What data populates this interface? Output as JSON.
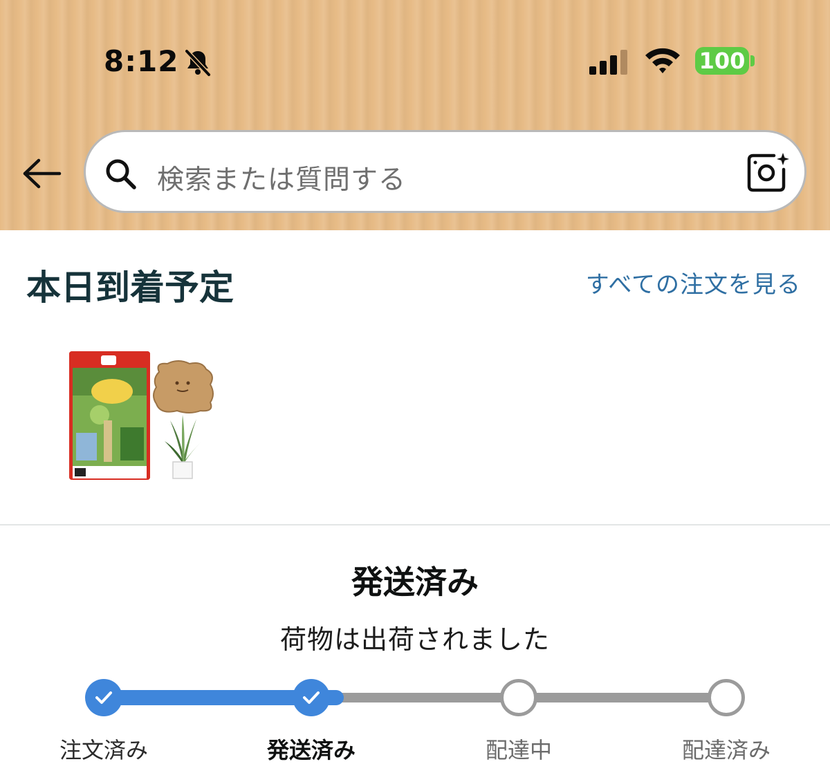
{
  "status_bar": {
    "time": "8:12",
    "battery": "100",
    "battery_color": "#5ecb45",
    "icons": [
      "bell-slash-icon",
      "cellular-signal-icon",
      "wifi-icon",
      "battery-icon"
    ]
  },
  "header": {
    "background_color": "#e7bb86",
    "search": {
      "placeholder": "検索または質問する",
      "icons": [
        "back-arrow-icon",
        "search-icon",
        "camera-lens-icon"
      ]
    }
  },
  "delivery": {
    "title": "本日到着予定",
    "view_all_link": "すべての注文を見る",
    "link_color": "#2f6fa3",
    "products": [
      {
        "name": "game-package-image"
      },
      {
        "name": "wooden-plate-image"
      },
      {
        "name": "potted-plant-image"
      }
    ]
  },
  "shipment": {
    "status_title": "発送済み",
    "status_message": "荷物は出荷されました",
    "progress_color": "#3f86db",
    "progress_fraction": 0.385,
    "steps": [
      {
        "label": "注文済み",
        "state": "done"
      },
      {
        "label": "発送済み",
        "state": "current"
      },
      {
        "label": "配達中",
        "state": "pending"
      },
      {
        "label": "配達済み",
        "state": "pending"
      }
    ]
  }
}
